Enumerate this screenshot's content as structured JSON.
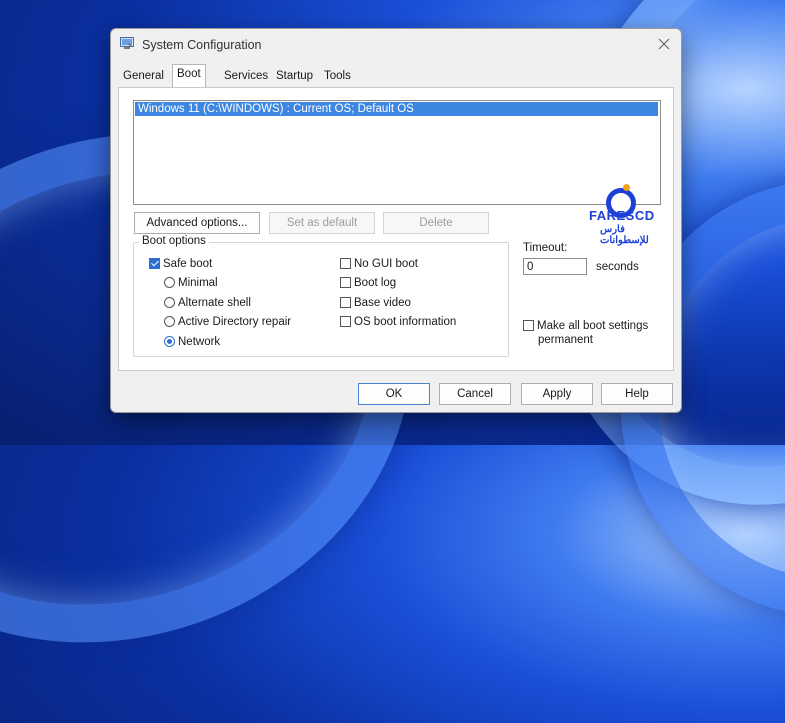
{
  "window": {
    "title": "System Configuration"
  },
  "tabs": [
    {
      "label": "General",
      "active": false
    },
    {
      "label": "Boot",
      "active": true
    },
    {
      "label": "Services",
      "active": false
    },
    {
      "label": "Startup",
      "active": false
    },
    {
      "label": "Tools",
      "active": false
    }
  ],
  "os_list": {
    "entries": [
      "Windows 11 (C:\\WINDOWS) : Current OS; Default OS"
    ]
  },
  "os_buttons": {
    "advanced": "Advanced options...",
    "set_default": "Set as default",
    "delete": "Delete"
  },
  "boot_options": {
    "legend": "Boot options",
    "safe_boot": {
      "label": "Safe boot",
      "checked": true
    },
    "minimal": {
      "label": "Minimal",
      "checked": false
    },
    "alternate_shell": {
      "label": "Alternate shell",
      "checked": false
    },
    "active_directory_repair": {
      "label": "Active Directory repair",
      "checked": false
    },
    "network": {
      "label": "Network",
      "checked": true
    },
    "no_gui_boot": {
      "label": "No GUI boot",
      "checked": false
    },
    "boot_log": {
      "label": "Boot log",
      "checked": false
    },
    "base_video": {
      "label": "Base video",
      "checked": false
    },
    "os_boot_information": {
      "label": "OS boot information",
      "checked": false
    }
  },
  "timeout": {
    "label": "Timeout:",
    "value": "0",
    "unit": "seconds"
  },
  "make_permanent": {
    "label_line1": "Make all boot settings",
    "label_line2": "permanent",
    "checked": false
  },
  "footer": {
    "ok": "OK",
    "cancel": "Cancel",
    "apply": "Apply",
    "help": "Help"
  },
  "watermark": {
    "brand": "FARESCD",
    "arabic": "فارس للإسطوانات"
  },
  "colors": {
    "accent": "#2e6dd1",
    "selection": "#3d86e1",
    "watermark": "#1f40d6",
    "watermark_dot": "#f3a21a"
  }
}
